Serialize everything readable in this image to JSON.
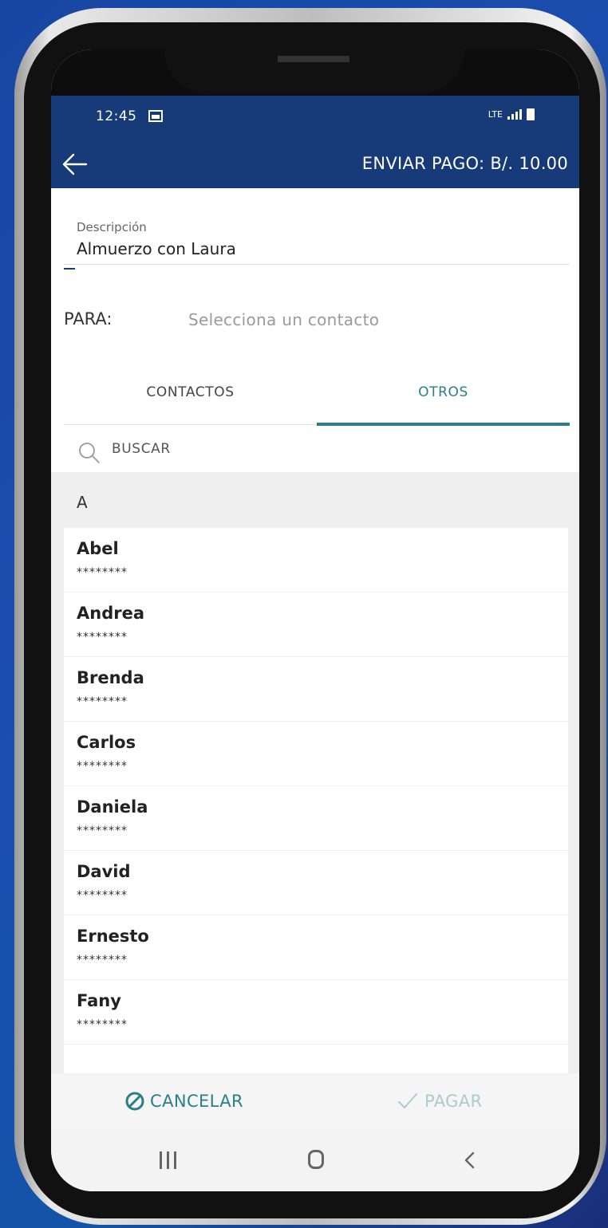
{
  "status_bar": {
    "time": "12:45",
    "network": "LTE"
  },
  "appbar": {
    "title": "ENVIAR PAGO: B/. 10.00"
  },
  "description": {
    "label": "Descripción",
    "value": "Almuerzo con Laura"
  },
  "recipient": {
    "label": "PARA:",
    "placeholder": "Selecciona un contacto"
  },
  "tabs": [
    {
      "label": "CONTACTOS",
      "selected": false
    },
    {
      "label": "OTROS",
      "selected": true
    }
  ],
  "search": {
    "placeholder": "BUSCAR"
  },
  "section": {
    "letter": "A"
  },
  "contacts": [
    {
      "name": "Abel",
      "masked": "********"
    },
    {
      "name": "Andrea",
      "masked": "********"
    },
    {
      "name": "Brenda",
      "masked": "********"
    },
    {
      "name": "Carlos",
      "masked": "********"
    },
    {
      "name": "Daniela",
      "masked": "********"
    },
    {
      "name": "David",
      "masked": "********"
    },
    {
      "name": "Ernesto",
      "masked": "********"
    },
    {
      "name": "Fany",
      "masked": "********"
    }
  ],
  "actions": {
    "cancel_label": "CANCELAR",
    "pay_label": "PAGAR"
  },
  "colors": {
    "primary": "#173a79",
    "accent": "#2a7f87",
    "disabled": "#a9ccd0"
  }
}
